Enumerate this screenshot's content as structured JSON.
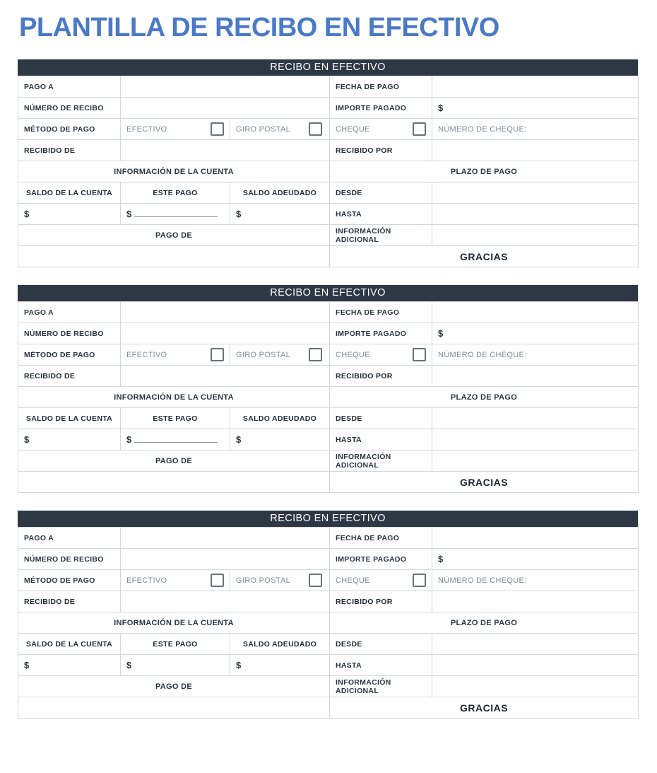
{
  "page_title": "PLANTILLA DE RECIBO EN EFECTIVO",
  "colors": {
    "title": "#4a7ac7",
    "header_bar": "#2e3744",
    "label_light": "#eceff4",
    "label_dark": "#aab4c6",
    "border": "#d3d7dd",
    "muted_text": "#808a96"
  },
  "receipt": {
    "header": "RECIBO EN EFECTIVO",
    "labels": {
      "pago_a": "PAGO A",
      "numero_de_recibo": "NÚMERO DE RECIBO",
      "metodo_de_pago": "MÉTODO DE PAGO",
      "recibido_de": "RECIBIDO DE",
      "fecha_de_pago": "FECHA DE PAGO",
      "importe_pagado": "IMPORTE PAGADO",
      "recibido_por": "RECIBIDO POR",
      "info_cuenta": "INFORMACIÓN DE LA CUENTA",
      "plazo_de_pago": "PLAZO DE PAGO",
      "saldo_de_la_cuenta": "SALDO DE LA CUENTA",
      "este_pago": "ESTE PAGO",
      "saldo_adeudado": "SALDO ADEUDADO",
      "desde": "DESDE",
      "hasta": "HASTA",
      "informacion_adicional": "INFORMACIÓN ADICIONAL",
      "pago_de": "PAGO DE",
      "gracias": "GRACIAS"
    },
    "payment_methods": {
      "efectivo": "EFECTIVO",
      "giro_postal": "GIRO POSTAL",
      "cheque": "CHEQUE",
      "numero_de_cheque": "NÚMERO DE CHEQUE:"
    },
    "currency_symbol": "$",
    "values": {
      "pago_a": "",
      "numero_de_recibo": "",
      "fecha_de_pago": "",
      "importe_pagado": "",
      "recibido_de": "",
      "recibido_por": "",
      "numero_de_cheque": "",
      "saldo_de_la_cuenta": "",
      "este_pago": "",
      "saldo_adeudado": "",
      "desde": "",
      "hasta": "",
      "informacion_adicional": "",
      "pago_de": ""
    },
    "checkboxes": {
      "efectivo_checked": false,
      "giro_postal_checked": false,
      "cheque_checked": false
    }
  },
  "receipt_count": 3,
  "este_pago_has_rule": [
    true,
    true,
    false
  ]
}
